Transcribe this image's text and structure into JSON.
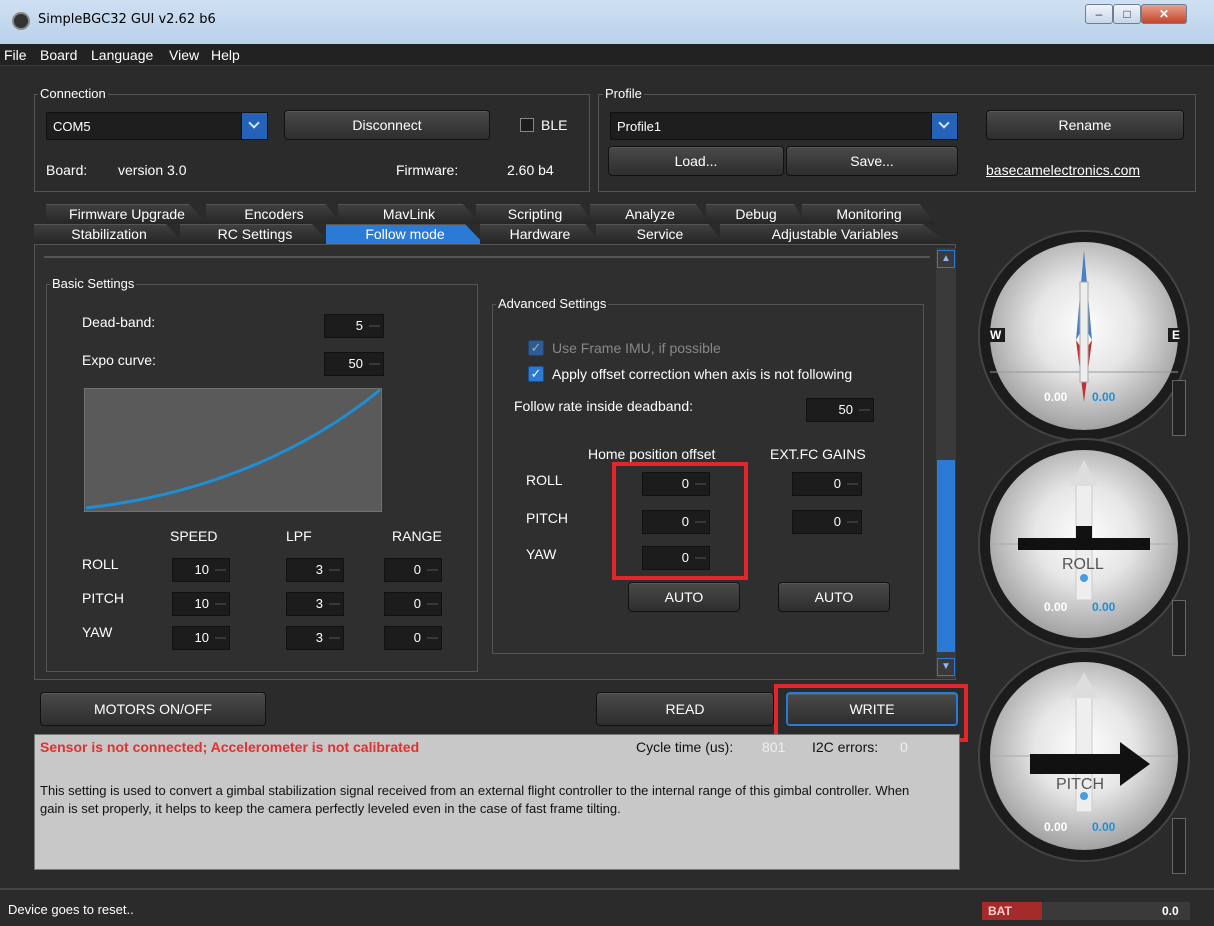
{
  "window": {
    "title": "SimpleBGC32 GUI v2.62 b6",
    "controls": [
      "minimize",
      "maximize",
      "close"
    ]
  },
  "menu": [
    "File",
    "Board",
    "Language",
    "View",
    "Help"
  ],
  "connection": {
    "legend": "Connection",
    "port": "COM5",
    "disconnect": "Disconnect",
    "ble": "BLE",
    "board_label": "Board:",
    "board_value": "version 3.0",
    "firmware_label": "Firmware:",
    "firmware_value": "2.60 b4"
  },
  "profile": {
    "legend": "Profile",
    "value": "Profile1",
    "load": "Load...",
    "save": "Save...",
    "rename": "Rename",
    "link": "basecamelectronics.com"
  },
  "tabs_row1": [
    "Firmware Upgrade",
    "Encoders",
    "MavLink",
    "Scripting",
    "Analyze",
    "Debug",
    "Monitoring"
  ],
  "tabs_row2": [
    "Stabilization",
    "RC Settings",
    "Follow mode",
    "Hardware",
    "Service",
    "Adjustable Variables"
  ],
  "basic": {
    "legend": "Basic Settings",
    "deadband_label": "Dead-band:",
    "deadband": "5",
    "expo_label": "Expo curve:",
    "expo": "50",
    "cols": [
      "SPEED",
      "LPF",
      "RANGE"
    ],
    "rows": [
      {
        "axis": "ROLL",
        "speed": "10",
        "lpf": "3",
        "range": "0"
      },
      {
        "axis": "PITCH",
        "speed": "10",
        "lpf": "3",
        "range": "0"
      },
      {
        "axis": "YAW",
        "speed": "10",
        "lpf": "3",
        "range": "0"
      }
    ]
  },
  "advanced": {
    "legend": "Advanced Settings",
    "frame_imu": "Use Frame IMU, if possible",
    "offset_corr": "Apply offset correction when axis is not following",
    "rate_label": "Follow rate inside deadband:",
    "rate": "50",
    "home_header": "Home position offset",
    "ext_header": "EXT.FC GAINS",
    "rows": [
      {
        "axis": "ROLL",
        "home": "0",
        "ext": "0"
      },
      {
        "axis": "PITCH",
        "home": "0",
        "ext": "0"
      },
      {
        "axis": "YAW",
        "home": "0"
      }
    ],
    "auto": "AUTO"
  },
  "actions": {
    "motors": "MOTORS ON/OFF",
    "read": "READ",
    "write": "WRITE"
  },
  "status": {
    "error": "Sensor is not connected; Accelerometer is not calibrated",
    "cycle_label": "Cycle time (us):",
    "cycle": "801",
    "i2c_label": "I2C errors:",
    "i2c": "0",
    "help": "This setting is used to convert a gimbal stabilization signal received from an external flight controller to the internal range of this gimbal controller. When gain is set properly, it helps to keep the camera perfectly leveled even in the case of fast frame tilting."
  },
  "gauges": [
    {
      "name": "yaw",
      "left": "W",
      "right": "E",
      "v1": "0.00",
      "v2": "0.00"
    },
    {
      "name": "roll",
      "label": "ROLL",
      "v1": "0.00",
      "v2": "0.00"
    },
    {
      "name": "pitch",
      "label": "PITCH",
      "v1": "0.00",
      "v2": "0.00"
    }
  ],
  "footer": {
    "message": "Device goes to reset..",
    "bat_label": "BAT",
    "bat_value": "0.0"
  },
  "colors": {
    "accent": "#2a7ad6",
    "error": "#e03030",
    "highlight": "#e3262b"
  }
}
